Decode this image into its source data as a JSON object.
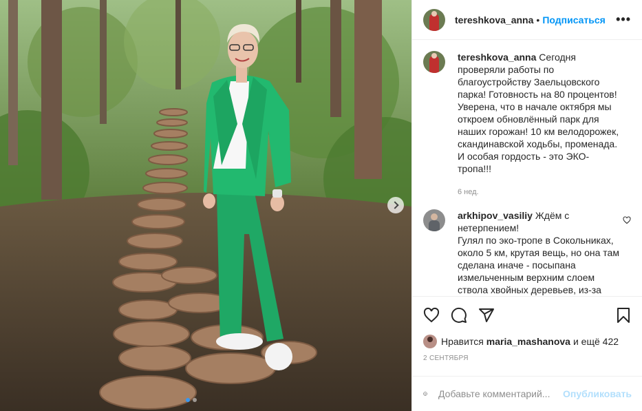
{
  "post": {
    "username": "tereshkova_anna",
    "follow_label": "Подписаться",
    "more_icon": "more-icon",
    "caption": "Сегодня проверяли работы по благоустройству Заельцовского парка! Готовность на 80 процентов! Уверена, что в начале октября мы откроем обновлённый парк для наших горожан! 10 км велодорожек, скандинавской ходьбы, променада. И особая гордость - это ЭКО- тропа!!!",
    "caption_time": "6 нед."
  },
  "comments": [
    {
      "username": "arkhipov_vasiliy",
      "text": "Ждём с нетерпением!\nГулял по эко-тропе в Сокольниках, около 5 км, крутая вещь, но она там сделана иначе - посыпана измельченным верхним слоем ствола хвойных деревьев, из-за"
    }
  ],
  "actions": {
    "icons": [
      "heart-icon",
      "comment-icon",
      "share-icon",
      "bookmark-icon"
    ]
  },
  "likes": {
    "prefix": "Нравится",
    "user": "maria_mashanova",
    "suffix": "и ещё 422"
  },
  "date": "2 сентября",
  "add_comment": {
    "placeholder": "Добавьте комментарий...",
    "publish_label": "Опубликовать"
  },
  "carousel": {
    "slides": 2,
    "current": 1
  },
  "colors": {
    "accent": "#0095f6",
    "publish_disabled": "#b2dffc",
    "suit": "#1fb36a"
  }
}
